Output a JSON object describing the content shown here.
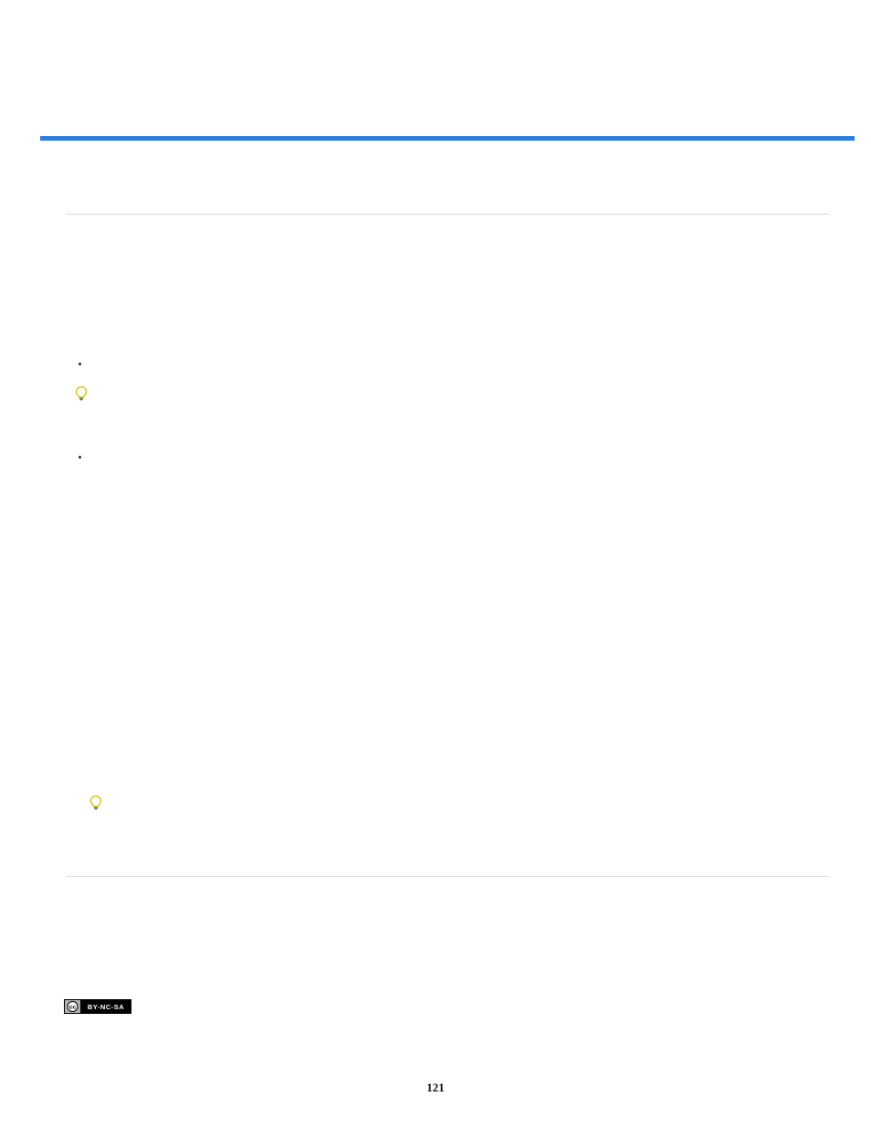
{
  "page_number": "121",
  "top_spacer_text": "",
  "items": {
    "0": "",
    "1": "",
    "tip_after_1": "",
    "2": "",
    "paragraph_after_2": "",
    "tip_bottom": ""
  },
  "cc_badge_label": "CC BY-NC-SA"
}
